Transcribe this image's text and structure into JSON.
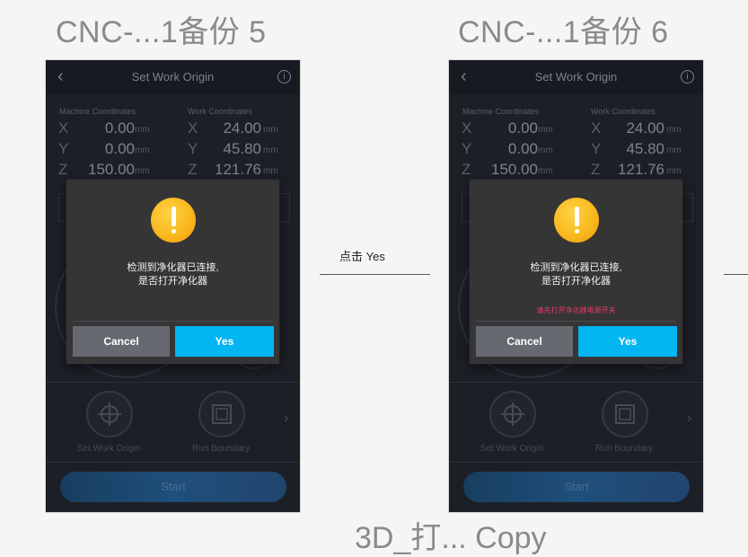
{
  "frames": [
    {
      "title": "CNC-...1备份 5",
      "screen": {
        "header_title": "Set Work Origin",
        "machine_label": "Machine Coordinates",
        "work_label": "Work Coordinates",
        "rows": [
          {
            "axis": "X",
            "machine": "0.00",
            "work": "24.00",
            "unit": "mm"
          },
          {
            "axis": "Y",
            "machine": "0.00",
            "work": "45.80",
            "unit": "mm"
          },
          {
            "axis": "Z",
            "machine": "150.00",
            "work": "121.76",
            "unit": "mm"
          }
        ],
        "tool_1": "Set Work Origin",
        "tool_2": "Run Boundary",
        "start_label": "Start"
      },
      "dialog": {
        "message_line1": "检测到净化器已连接,",
        "message_line2": "是否打开净化器",
        "hint": "",
        "cancel_label": "Cancel",
        "yes_label": "Yes"
      }
    },
    {
      "title": "CNC-...1备份 6",
      "screen": {
        "header_title": "Set Work Origin",
        "machine_label": "Machine Coordinates",
        "work_label": "Work Coordinates",
        "rows": [
          {
            "axis": "X",
            "machine": "0.00",
            "work": "24.00",
            "unit": "mm"
          },
          {
            "axis": "Y",
            "machine": "0.00",
            "work": "45.80",
            "unit": "mm"
          },
          {
            "axis": "Z",
            "machine": "150.00",
            "work": "121.76",
            "unit": "mm"
          }
        ],
        "tool_1": "Set Work Origin",
        "tool_2": "Run Boundary",
        "start_label": "Start"
      },
      "dialog": {
        "message_line1": "检测到净化器已连接,",
        "message_line2": "是否打开净化器",
        "hint": "请先打开净化器电源开关",
        "cancel_label": "Cancel",
        "yes_label": "Yes"
      }
    }
  ],
  "connector": {
    "label": "点击 Yes"
  },
  "bottom_title": "3D_打... Copy",
  "colors": {
    "accent": "#03b5f1",
    "warning": "#f9b91e",
    "hint": "#e23c66"
  }
}
